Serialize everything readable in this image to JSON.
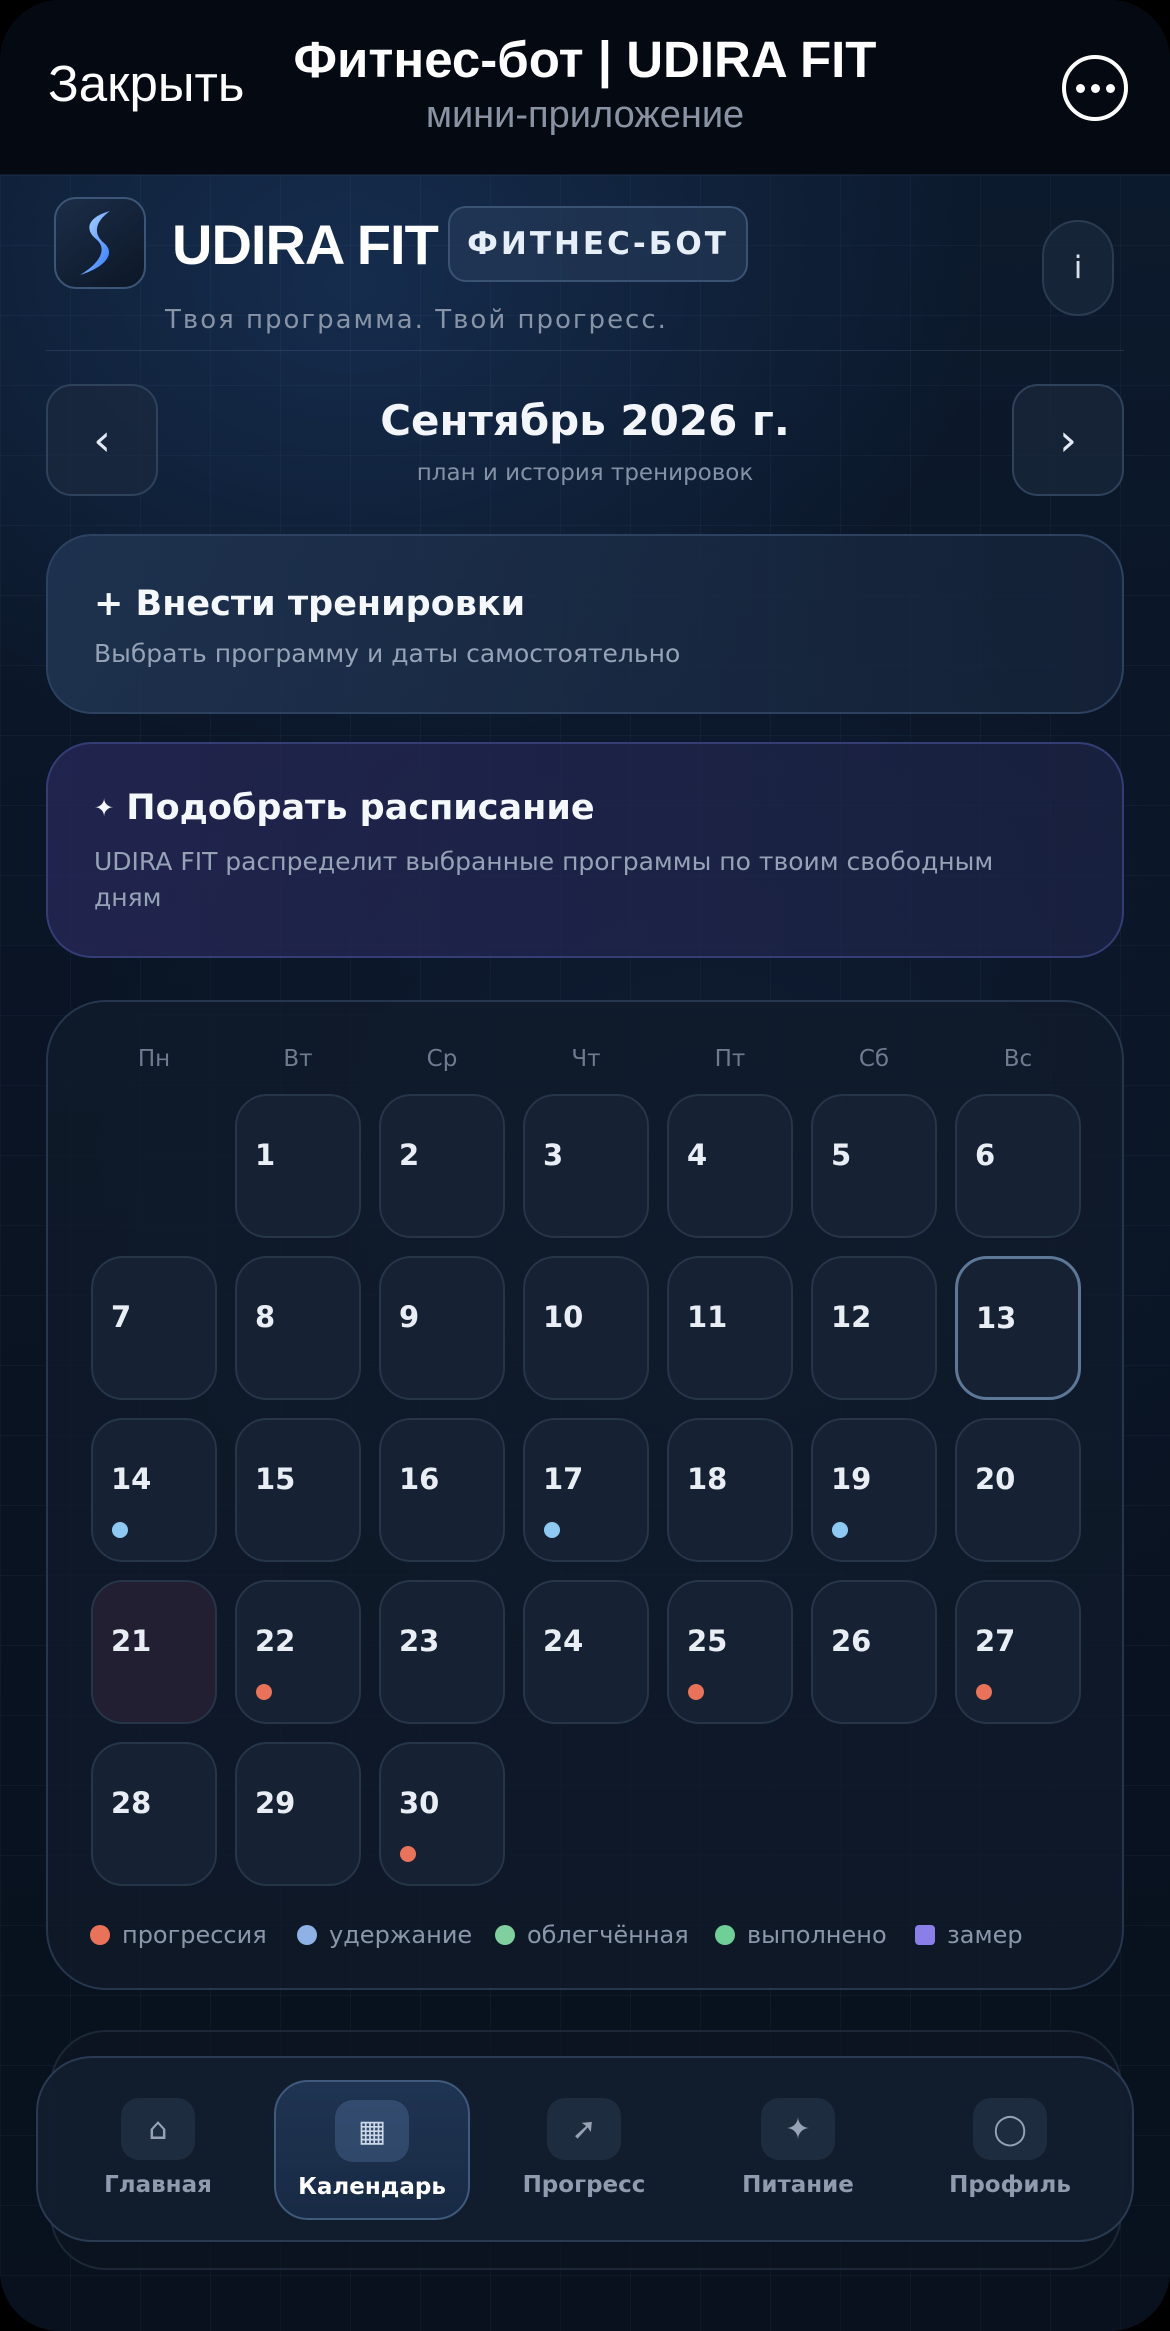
{
  "topbar": {
    "close_label": "Закрыть",
    "title": "Фитнес-бот | UDIRA FIT",
    "subtitle": "мини-приложение",
    "more_icon": "more-horizontal-icon"
  },
  "header": {
    "brand": "UDIRA FIT",
    "chip": "ФИТНЕС-БОТ",
    "info_label": "i",
    "tagline": "Твоя программа. Твой прогресс."
  },
  "month_nav": {
    "prev_label": "‹",
    "next_label": "›",
    "title": "Сентябрь 2026 г.",
    "subtitle": "план и история тренировок"
  },
  "actions": [
    {
      "icon": "+",
      "title": "Внести тренировки",
      "description": "Выбрать программу и даты самостоятельно"
    },
    {
      "icon": "✦",
      "title": "Подобрать расписание",
      "description": "UDIRA FIT распределит выбранные программы по твоим свободным дням"
    }
  ],
  "calendar": {
    "weekdays": [
      "Пн",
      "Вт",
      "Ср",
      "Чт",
      "Пт",
      "Сб",
      "Вс"
    ],
    "days": [
      "1",
      "2",
      "3",
      "4",
      "5",
      "6",
      "7",
      "8",
      "9",
      "10",
      "11",
      "12",
      "13",
      "14",
      "15",
      "16",
      "17",
      "18",
      "19",
      "20",
      "21",
      "22",
      "23",
      "24",
      "25",
      "26",
      "27",
      "28",
      "29",
      "30"
    ],
    "today": "13",
    "markers": {
      "14": "hold",
      "17": "hold",
      "19": "hold",
      "22": "progression",
      "25": "progression",
      "27": "progression",
      "30": "progression"
    }
  },
  "legend": [
    {
      "label": "прогрессия",
      "color": "#e8735a",
      "shape": "dot"
    },
    {
      "label": "удержание",
      "color": "#8fb2e6",
      "shape": "dot"
    },
    {
      "label": "облегчённая",
      "color": "#7fcf9f",
      "shape": "dot"
    },
    {
      "label": "выполнено",
      "color": "#6fcf97",
      "shape": "dot"
    },
    {
      "label": "замер",
      "color": "#8a7ee8",
      "shape": "square"
    }
  ],
  "marker_colors": {
    "progression": "#e8735a",
    "hold": "#8ec9f2"
  },
  "tabs": [
    {
      "label": "Главная",
      "icon": "home-icon",
      "glyph": "⌂",
      "active": false
    },
    {
      "label": "Календарь",
      "icon": "calendar-icon",
      "glyph": "▦",
      "active": true
    },
    {
      "label": "Прогресс",
      "icon": "trend-arrow-icon",
      "glyph": "➚",
      "active": false
    },
    {
      "label": "Питание",
      "icon": "sparkle-icon",
      "glyph": "✦",
      "active": false
    },
    {
      "label": "Профиль",
      "icon": "profile-circle-icon",
      "glyph": "◯",
      "active": false
    }
  ]
}
